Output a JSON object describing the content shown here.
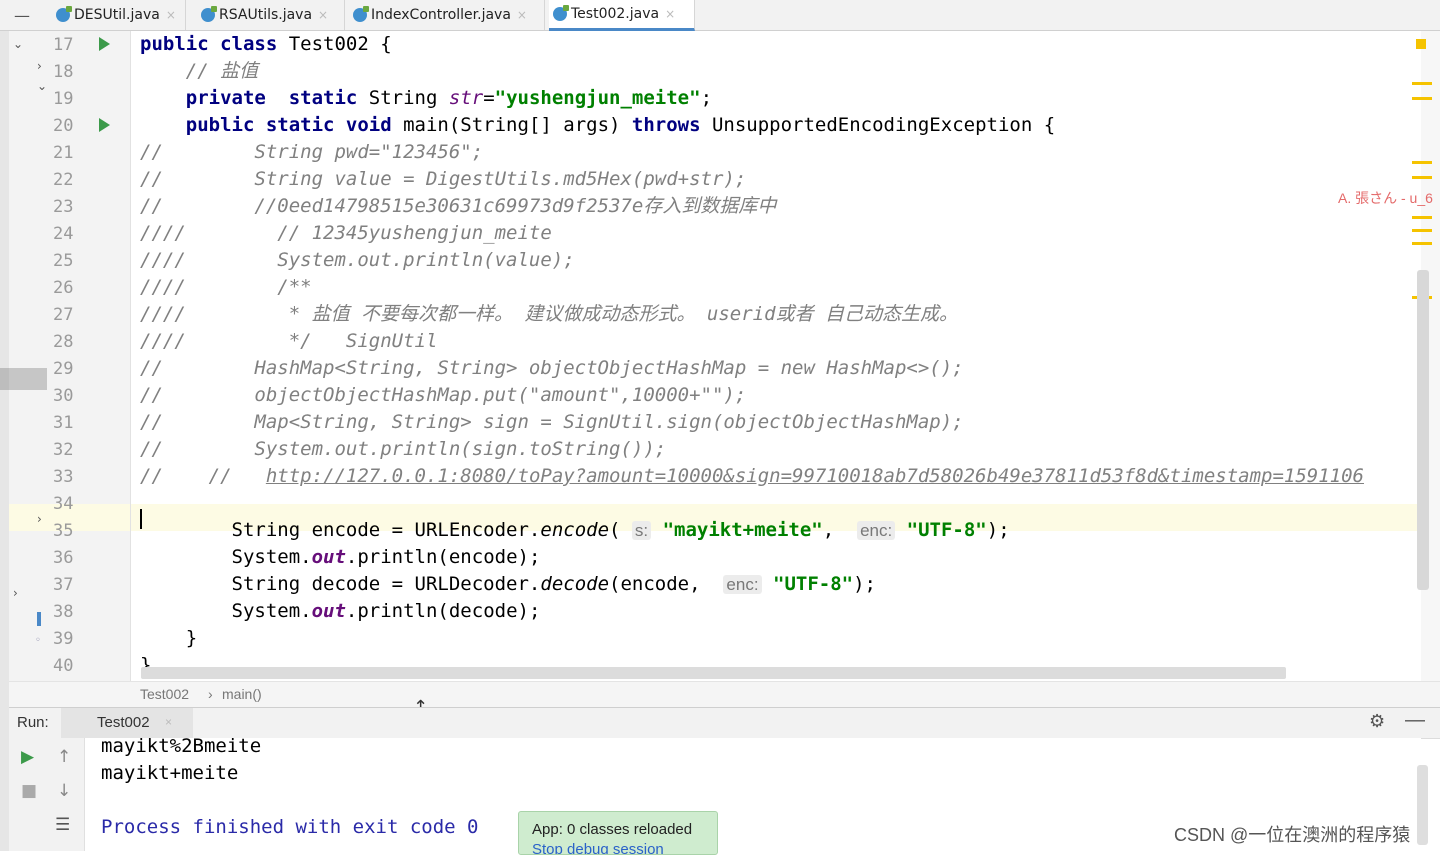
{
  "tabs": [
    {
      "label": "DESUtil.java",
      "close": "×"
    },
    {
      "label": "RSAUtils.java",
      "close": "×"
    },
    {
      "label": "IndexController.java",
      "close": "×"
    },
    {
      "label": "Test002.java",
      "close": "×"
    }
  ],
  "line_numbers": [
    "17",
    "18",
    "19",
    "20",
    "21",
    "22",
    "23",
    "24",
    "25",
    "26",
    "27",
    "28",
    "29",
    "30",
    "31",
    "32",
    "33",
    "34",
    "35",
    "36",
    "37",
    "38",
    "39",
    "40"
  ],
  "code": {
    "l17": {
      "a": "public class",
      "b": " Test002 {"
    },
    "l18": {
      "a": "    // 盐值"
    },
    "l19": {
      "a": "    ",
      "b": "private  static",
      "c": " String ",
      "d": "str",
      "e": "=",
      "f": "\"yushengjun_meite\"",
      "g": ";"
    },
    "l20": {
      "a": "    ",
      "b": "public static void",
      "c": " main(String[] args) ",
      "d": "throws",
      "e": " UnsupportedEncodingException {"
    },
    "l21": {
      "a": "//        String pwd=\"123456\";"
    },
    "l22": {
      "a": "//        String value = DigestUtils.md5Hex(pwd+str);"
    },
    "l23": {
      "a": "//        //0eed14798515e30631c69973d9f2537e存入到数据库中"
    },
    "l24": {
      "a": "////        // 12345yushengjun_meite"
    },
    "l25": {
      "a": "////        System.out.println(value);"
    },
    "l26": {
      "a": "////        /**"
    },
    "l27": {
      "a": "////         * 盐值 不要每次都一样。 建议做成动态形式。 userid或者 自己动态生成。"
    },
    "l28": {
      "a": "////         */   SignUtil"
    },
    "l29": {
      "a": "//        HashMap<String, String> objectObjectHashMap = new HashMap<>();"
    },
    "l30": {
      "a": "//        objectObjectHashMap.put(\"amount\",10000+\"\");"
    },
    "l31": {
      "a": "//        Map<String, String> sign = SignUtil.sign(objectObjectHashMap);"
    },
    "l32": {
      "a": "//        System.out.println(sign.toString());"
    },
    "l33": {
      "a": "//    //   ",
      "b": "http://127.0.0.1:8080/toPay?amount=10000&sign=99710018ab7d58026b49e37811d53f8d&timestamp=1591106"
    },
    "l35": {
      "a": "        String encode = URLEncoder.",
      "b": "encode",
      "c": "( ",
      "hint1": "s:",
      "d": " ",
      "e": "\"mayikt+meite\"",
      "f": ",  ",
      "hint2": "enc:",
      "g": " ",
      "h": "\"UTF-8\"",
      "i": ");"
    },
    "l36": {
      "a": "        System.",
      "b": "out",
      "c": ".println(encode);"
    },
    "l37": {
      "a": "        String decode = URLDecoder.",
      "b": "decode",
      "c": "(encode,  ",
      "hint": "enc:",
      "d": " ",
      "e": "\"UTF-8\"",
      "f": ");"
    },
    "l38": {
      "a": "        System.",
      "b": "out",
      "c": ".println(decode);"
    },
    "l39": {
      "a": "    }"
    },
    "l40": {
      "a": "}"
    }
  },
  "overlay_name": "A. 張さん - u_6",
  "breadcrumb": {
    "class": "Test002",
    "sep": "›",
    "method": "main()"
  },
  "run_panel": {
    "label": "Run:",
    "tab": "Test002",
    "tab_close": "×"
  },
  "console": {
    "line1": "mayikt%2Bmeite",
    "line2": "mayikt+meite",
    "line3": "Process finished with exit code 0"
  },
  "notification": {
    "title": "App: 0 classes reloaded",
    "link": "Stop debug session"
  },
  "watermark": "CSDN @一位在澳洲的程序猿",
  "colors": {
    "keyword": "#000080",
    "string": "#008000",
    "comment": "#808080",
    "static_field": "#660e7a",
    "run_green": "#3c9a4a",
    "marker_yellow": "#f5c300"
  }
}
